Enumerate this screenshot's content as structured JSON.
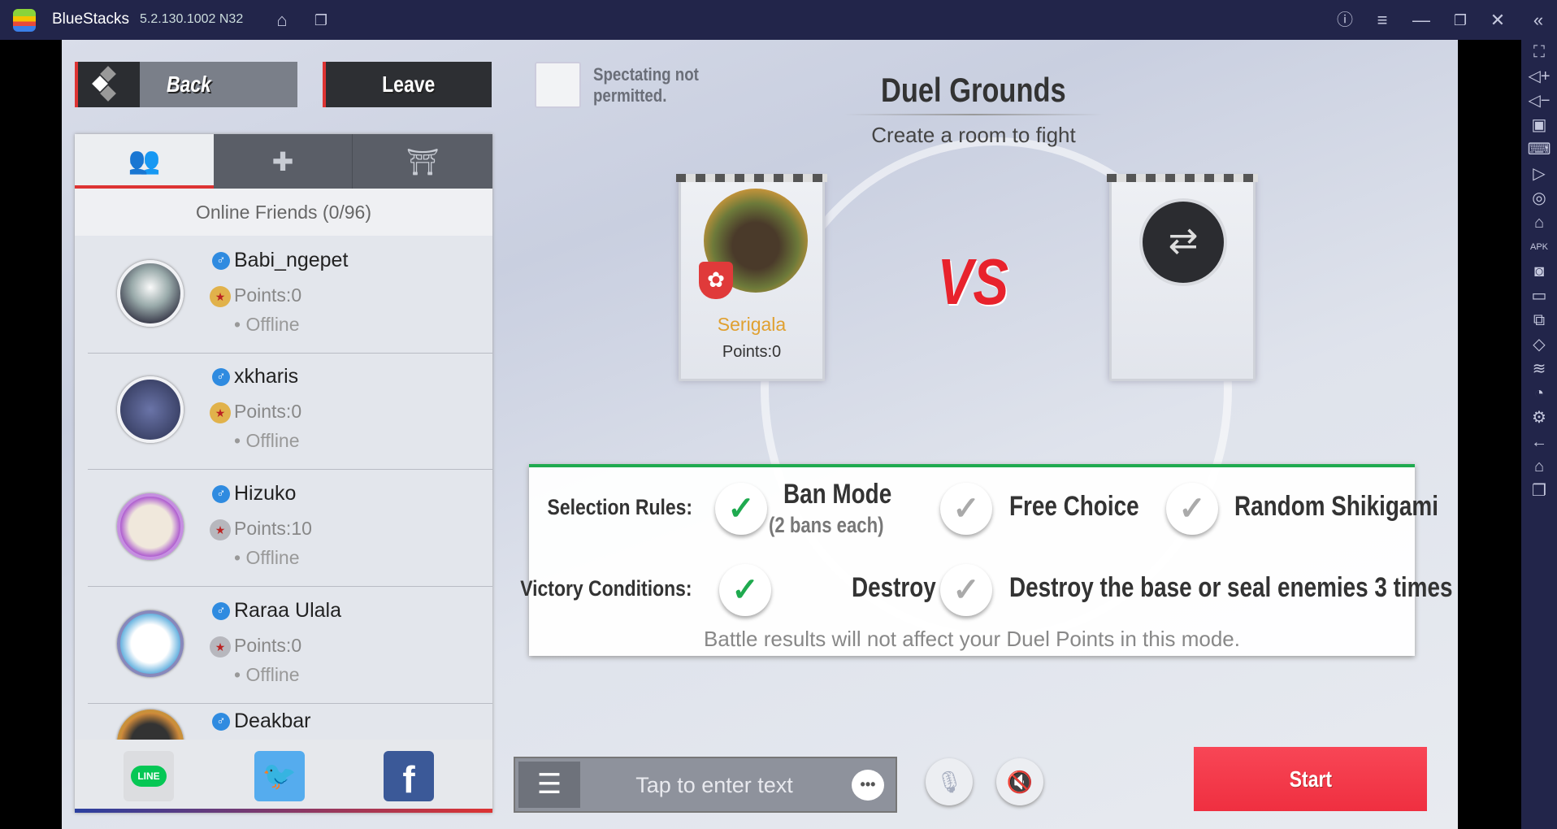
{
  "titlebar": {
    "app_name": "BlueStacks",
    "version": "5.2.130.1002 N32",
    "icons": [
      "bluestacks-logo",
      "home-icon",
      "multi-instance-icon",
      "help-icon",
      "menu-icon",
      "minimize-icon",
      "restore-icon",
      "close-icon",
      "collapse-sidebar-icon"
    ]
  },
  "top": {
    "back_label": "Back",
    "leave_label": "Leave",
    "spectating_label": "Spectating not permitted.",
    "spectating_checked": false
  },
  "friends": {
    "tabs": [
      {
        "icon": "friends-icon",
        "active": true
      },
      {
        "icon": "add-bookmark-icon",
        "active": false
      },
      {
        "icon": "torii-gate-icon",
        "active": false
      }
    ],
    "header": "Online Friends (0/96)",
    "items": [
      {
        "name": "Babi_ngepet",
        "points": "Points:0",
        "status": "Offline"
      },
      {
        "name": "xkharis",
        "points": "Points:0",
        "status": "Offline"
      },
      {
        "name": "Hizuko",
        "points": "Points:10",
        "status": "Offline"
      },
      {
        "name": "Raraa Ulala",
        "points": "Points:0",
        "status": "Offline"
      },
      {
        "name": "Deakbar",
        "points": "",
        "status": ""
      }
    ],
    "social": [
      {
        "name": "LINE",
        "color": "#06c755"
      },
      {
        "name": "twitter",
        "color": "#55acee"
      },
      {
        "name": "facebook",
        "color": "#3b5998"
      }
    ]
  },
  "duel": {
    "title": "Duel Grounds",
    "subtitle": "Create a room to fight",
    "player": {
      "name": "Serigala",
      "points": "Points:0"
    },
    "vs": "VS",
    "opponent_icon": "swap-icon"
  },
  "rules": {
    "selection_label": "Selection Rules:",
    "selection_options": [
      {
        "label": "Ban Mode",
        "sub": "(2 bans each)",
        "checked": true
      },
      {
        "label": "Free Choice",
        "checked": false
      },
      {
        "label": "Random Shikigami",
        "checked": false
      }
    ],
    "victory_label": "Victory Conditions:",
    "victory_options": [
      {
        "label": "Destroy the base",
        "checked": true
      },
      {
        "label": "Destroy the base or seal enemies 3 times",
        "checked": false
      }
    ],
    "notice": "Battle results will not affect your Duel Points in this mode."
  },
  "chat": {
    "placeholder": "Tap to enter text"
  },
  "start_label": "Start",
  "colors": {
    "accent_red": "#f23a4a",
    "check_green": "#1faa4f",
    "titlebar": "#22254a",
    "vs_red": "#e8222c"
  }
}
